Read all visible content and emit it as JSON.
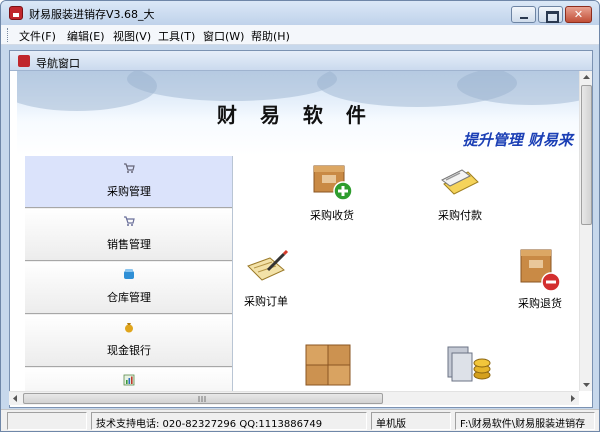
{
  "window": {
    "title": "财易服装进销存V3.68_大"
  },
  "menu": [
    {
      "label": "文件(F)"
    },
    {
      "label": "编辑(E)"
    },
    {
      "label": "视图(V)"
    },
    {
      "label": "工具(T)"
    },
    {
      "label": "窗口(W)"
    },
    {
      "label": "帮助(H)"
    }
  ],
  "panel": {
    "title": "导航窗口"
  },
  "banner": {
    "brand": "财 易 软 件",
    "slogan": "提升管理 财易来"
  },
  "nav": [
    {
      "label": "采购管理",
      "icon": "cart-icon",
      "active": true
    },
    {
      "label": "销售管理",
      "icon": "cart-icon"
    },
    {
      "label": "仓库管理",
      "icon": "warehouse-icon"
    },
    {
      "label": "现金银行",
      "icon": "money-bag-icon"
    },
    {
      "label": "",
      "icon": "chart-icon"
    }
  ],
  "actions": [
    {
      "label": "采购收货",
      "icon": "receive-box-icon"
    },
    {
      "label": "采购付款",
      "icon": "payment-icon"
    },
    {
      "label": "采购订单",
      "icon": "order-pen-icon"
    },
    {
      "label": "采购退货",
      "icon": "return-box-icon"
    },
    {
      "label": "",
      "icon": "boxes-icon"
    },
    {
      "label": "",
      "icon": "cash-coins-icon"
    }
  ],
  "status": {
    "support": "技术支持电话: 020-82327296 QQ:1113886749",
    "edition": "单机版",
    "path": "F:\\财易软件\\财易服装进销存"
  }
}
